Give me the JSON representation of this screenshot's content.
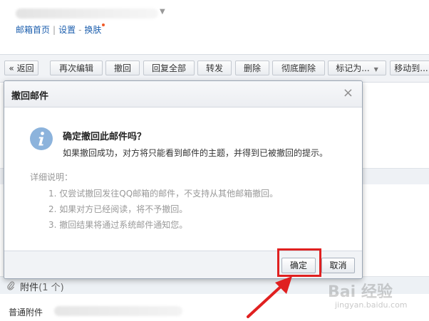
{
  "header": {
    "links": [
      "邮箱首页",
      "设置",
      "换肤"
    ],
    "link_sep": "|",
    "link_dash": "-"
  },
  "toolbar": {
    "items": [
      {
        "label": "« 返回"
      },
      {
        "label": "再次编辑"
      },
      {
        "label": "撤回"
      },
      {
        "label": "回复全部"
      },
      {
        "label": "转发"
      },
      {
        "label": "删除"
      },
      {
        "label": "彻底删除"
      },
      {
        "label": "标记为..."
      },
      {
        "label": "移动到..."
      }
    ]
  },
  "dialog": {
    "title": "撤回邮件",
    "close_glyph": "×",
    "question": "确定撤回此邮件吗？",
    "description": "如果撤回成功，对方将只能看到邮件的主题，并得到已被撤回的提示。",
    "detail_label": "详细说明：",
    "details": [
      "1. 仅尝试撤回发往QQ邮箱的邮件，不支持从其他邮箱撤回。",
      "2. 如果对方已经阅读，将不予撤回。",
      "3. 撤回结果将通过系统邮件通知您。"
    ],
    "ok_label": "确定",
    "cancel_label": "取消",
    "icon": "info-icon"
  },
  "attachments": {
    "section_label": "附件",
    "count": "(1 个)",
    "normal_label": "普通附件"
  },
  "watermark": {
    "main": "Bai 经验",
    "sub": "jingyan.baidu.com"
  },
  "colors": {
    "link": "#1d5fae",
    "highlight": "#e02020",
    "info_icon": "#8cb3dc",
    "toolbar_bg": "#f1f3f6"
  }
}
